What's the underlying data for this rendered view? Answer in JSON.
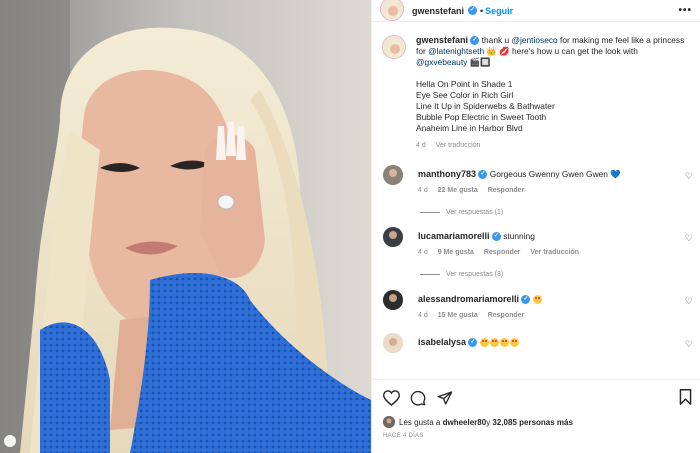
{
  "post": {
    "username": "gwenstefani",
    "follow_label": "Seguir",
    "more_label": "•••"
  },
  "caption": {
    "username": "gwenstefani",
    "text_a": "thank u ",
    "mention_1": "@jentioseco",
    "text_b": " for making me feel like a princess for ",
    "mention_2": "@latenightseth",
    "text_c": " 👑 💋 here's how u can get the look with ",
    "mention_3": "@gxvebeauty",
    "text_d": " 🎬🔲",
    "products": [
      "Hella On Point in Shade 1",
      "Eye See Color in Rich Girl",
      "Line It Up in Spiderwebs & Bathwater",
      "Bubble Pop Electric in Sweet Tooth",
      "Anaheim Line in Harbor Blvd"
    ],
    "time": "4 d",
    "translate_label": "Ver traducción"
  },
  "comments": [
    {
      "username": "manthony783",
      "text": "Gorgeous Gwenny Gwen Gwen",
      "emoji": "💙",
      "time": "4 d",
      "likes": "22 Me gusta",
      "reply_label": "Responder",
      "translate_label": "",
      "replies_label": "Ver respuestas (1)"
    },
    {
      "username": "lucamariamorelli",
      "text": "stunning",
      "emoji": "",
      "time": "4 d",
      "likes": "9 Me gusta",
      "reply_label": "Responder",
      "translate_label": "Ver traducción",
      "replies_label": "Ver respuestas (3)"
    },
    {
      "username": "alessandromariamorelli",
      "text": "",
      "emoji": "🤩",
      "time": "4 d",
      "likes": "15 Me gusta",
      "reply_label": "Responder",
      "translate_label": "",
      "replies_label": ""
    },
    {
      "username": "isabelalysa",
      "text": "",
      "emoji": "🤩🤩🤩🤩",
      "time": "",
      "likes": "",
      "reply_label": "",
      "translate_label": "",
      "replies_label": ""
    }
  ],
  "likes": {
    "prefix": "Les gusta a ",
    "user": "dwheeler80",
    "mid": " y ",
    "count": "32,085 personas más"
  },
  "posted_ago": "HACE 4 DÍAS",
  "colors": {
    "link": "#0095f6",
    "verified": "#3897f0",
    "mention": "#00376b",
    "secondary_text": "#8e8e8e"
  },
  "icons": {
    "like": "heart-outline-icon",
    "comment": "speech-bubble-icon",
    "share": "paper-plane-icon",
    "save": "bookmark-icon",
    "verified": "verified-badge-icon",
    "more": "ellipsis-icon"
  }
}
